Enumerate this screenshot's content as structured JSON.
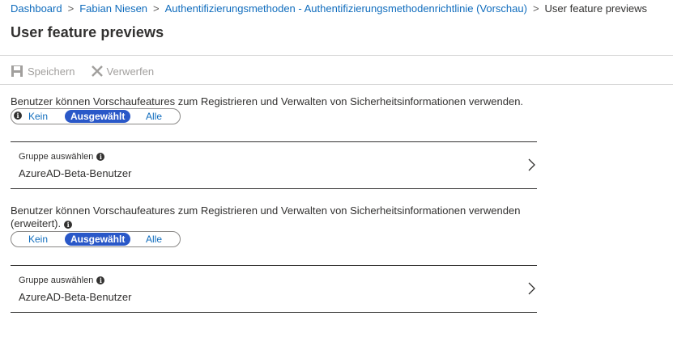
{
  "breadcrumb": {
    "items": [
      "Dashboard",
      "Fabian Niesen",
      "Authentifizierungsmethoden - Authentifizierungsmethodenrichtlinie (Vorschau)"
    ],
    "current": "User feature previews",
    "separator": ">"
  },
  "page": {
    "title": "User feature previews"
  },
  "toolbar": {
    "save_label": "Speichern",
    "discard_label": "Verwerfen"
  },
  "sections": [
    {
      "description": "Benutzer können Vorschaufeatures zum Registrieren und Verwalten von Sicherheitsinformationen verwenden.",
      "toggle": {
        "options": [
          "Kein",
          "Ausgewählt",
          "Alle"
        ],
        "selected": "Ausgewählt"
      },
      "group": {
        "label": "Gruppe auswählen",
        "value": "AzureAD-Beta-Benutzer"
      }
    },
    {
      "description": "Benutzer können Vorschaufeatures zum Registrieren und Verwalten von Sicherheitsinformationen verwenden (erweitert).",
      "toggle": {
        "options": [
          "Kein",
          "Ausgewählt",
          "Alle"
        ],
        "selected": "Ausgewählt"
      },
      "group": {
        "label": "Gruppe auswählen",
        "value": "AzureAD-Beta-Benutzer"
      }
    }
  ],
  "colors": {
    "link": "#0f6cbd",
    "selected_pill": "#2a58c8",
    "disabled": "#a19f9d"
  },
  "icons": {
    "save": "save-icon",
    "discard": "close-icon",
    "info": "info-icon",
    "chevron": "chevron-right-icon"
  }
}
